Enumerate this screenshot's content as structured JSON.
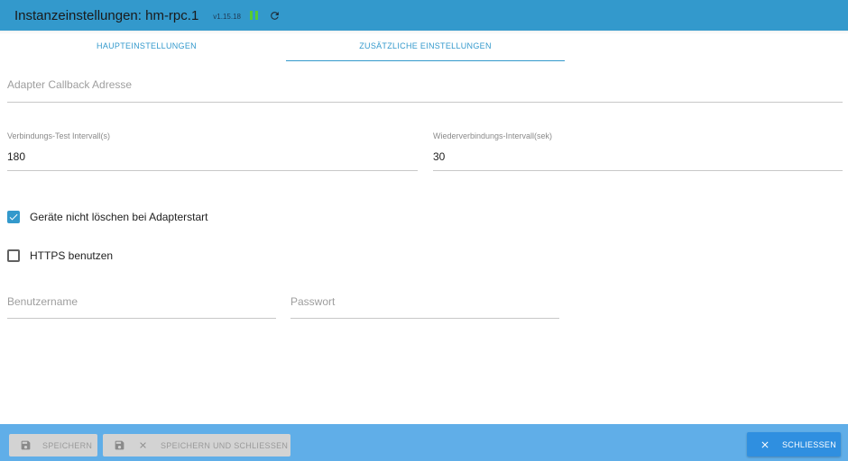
{
  "header": {
    "title": "Instanzeinstellungen: hm-rpc.1",
    "version": "v1.15.18"
  },
  "tabs": [
    {
      "label": "HAUPTEINSTELLUNGEN",
      "active": false
    },
    {
      "label": "ZUSÄTZLICHE EINSTELLUNGEN",
      "active": true
    }
  ],
  "fields": {
    "callback": {
      "placeholder": "Adapter Callback Adresse",
      "value": ""
    },
    "test_interval": {
      "label": "Verbindungs-Test Intervall(s)",
      "value": "180"
    },
    "reconnect_interval": {
      "label": "Wiederverbindungs-Intervall(sek)",
      "value": "30"
    },
    "username": {
      "placeholder": "Benutzername",
      "value": ""
    },
    "password": {
      "placeholder": "Passwort",
      "value": ""
    }
  },
  "checkboxes": {
    "dont_delete": {
      "label": "Geräte nicht löschen bei Adapterstart",
      "checked": true
    },
    "https": {
      "label": "HTTPS benutzen",
      "checked": false
    }
  },
  "footer": {
    "save_label": "SPEICHERN",
    "save_close_label": "SPEICHERN UND SCHLIESSEN",
    "close_label": "SCHLIESSEN"
  },
  "colors": {
    "header_bg": "#3399cc",
    "accent": "#3399cc",
    "footer_bg": "#60aee8",
    "primary_button": "#2f8fe0",
    "status_running": "#55cc33"
  },
  "icons": {
    "pause": "pause-icon",
    "reload": "reload-icon",
    "save": "floppy-disk-icon",
    "close": "close-icon"
  }
}
